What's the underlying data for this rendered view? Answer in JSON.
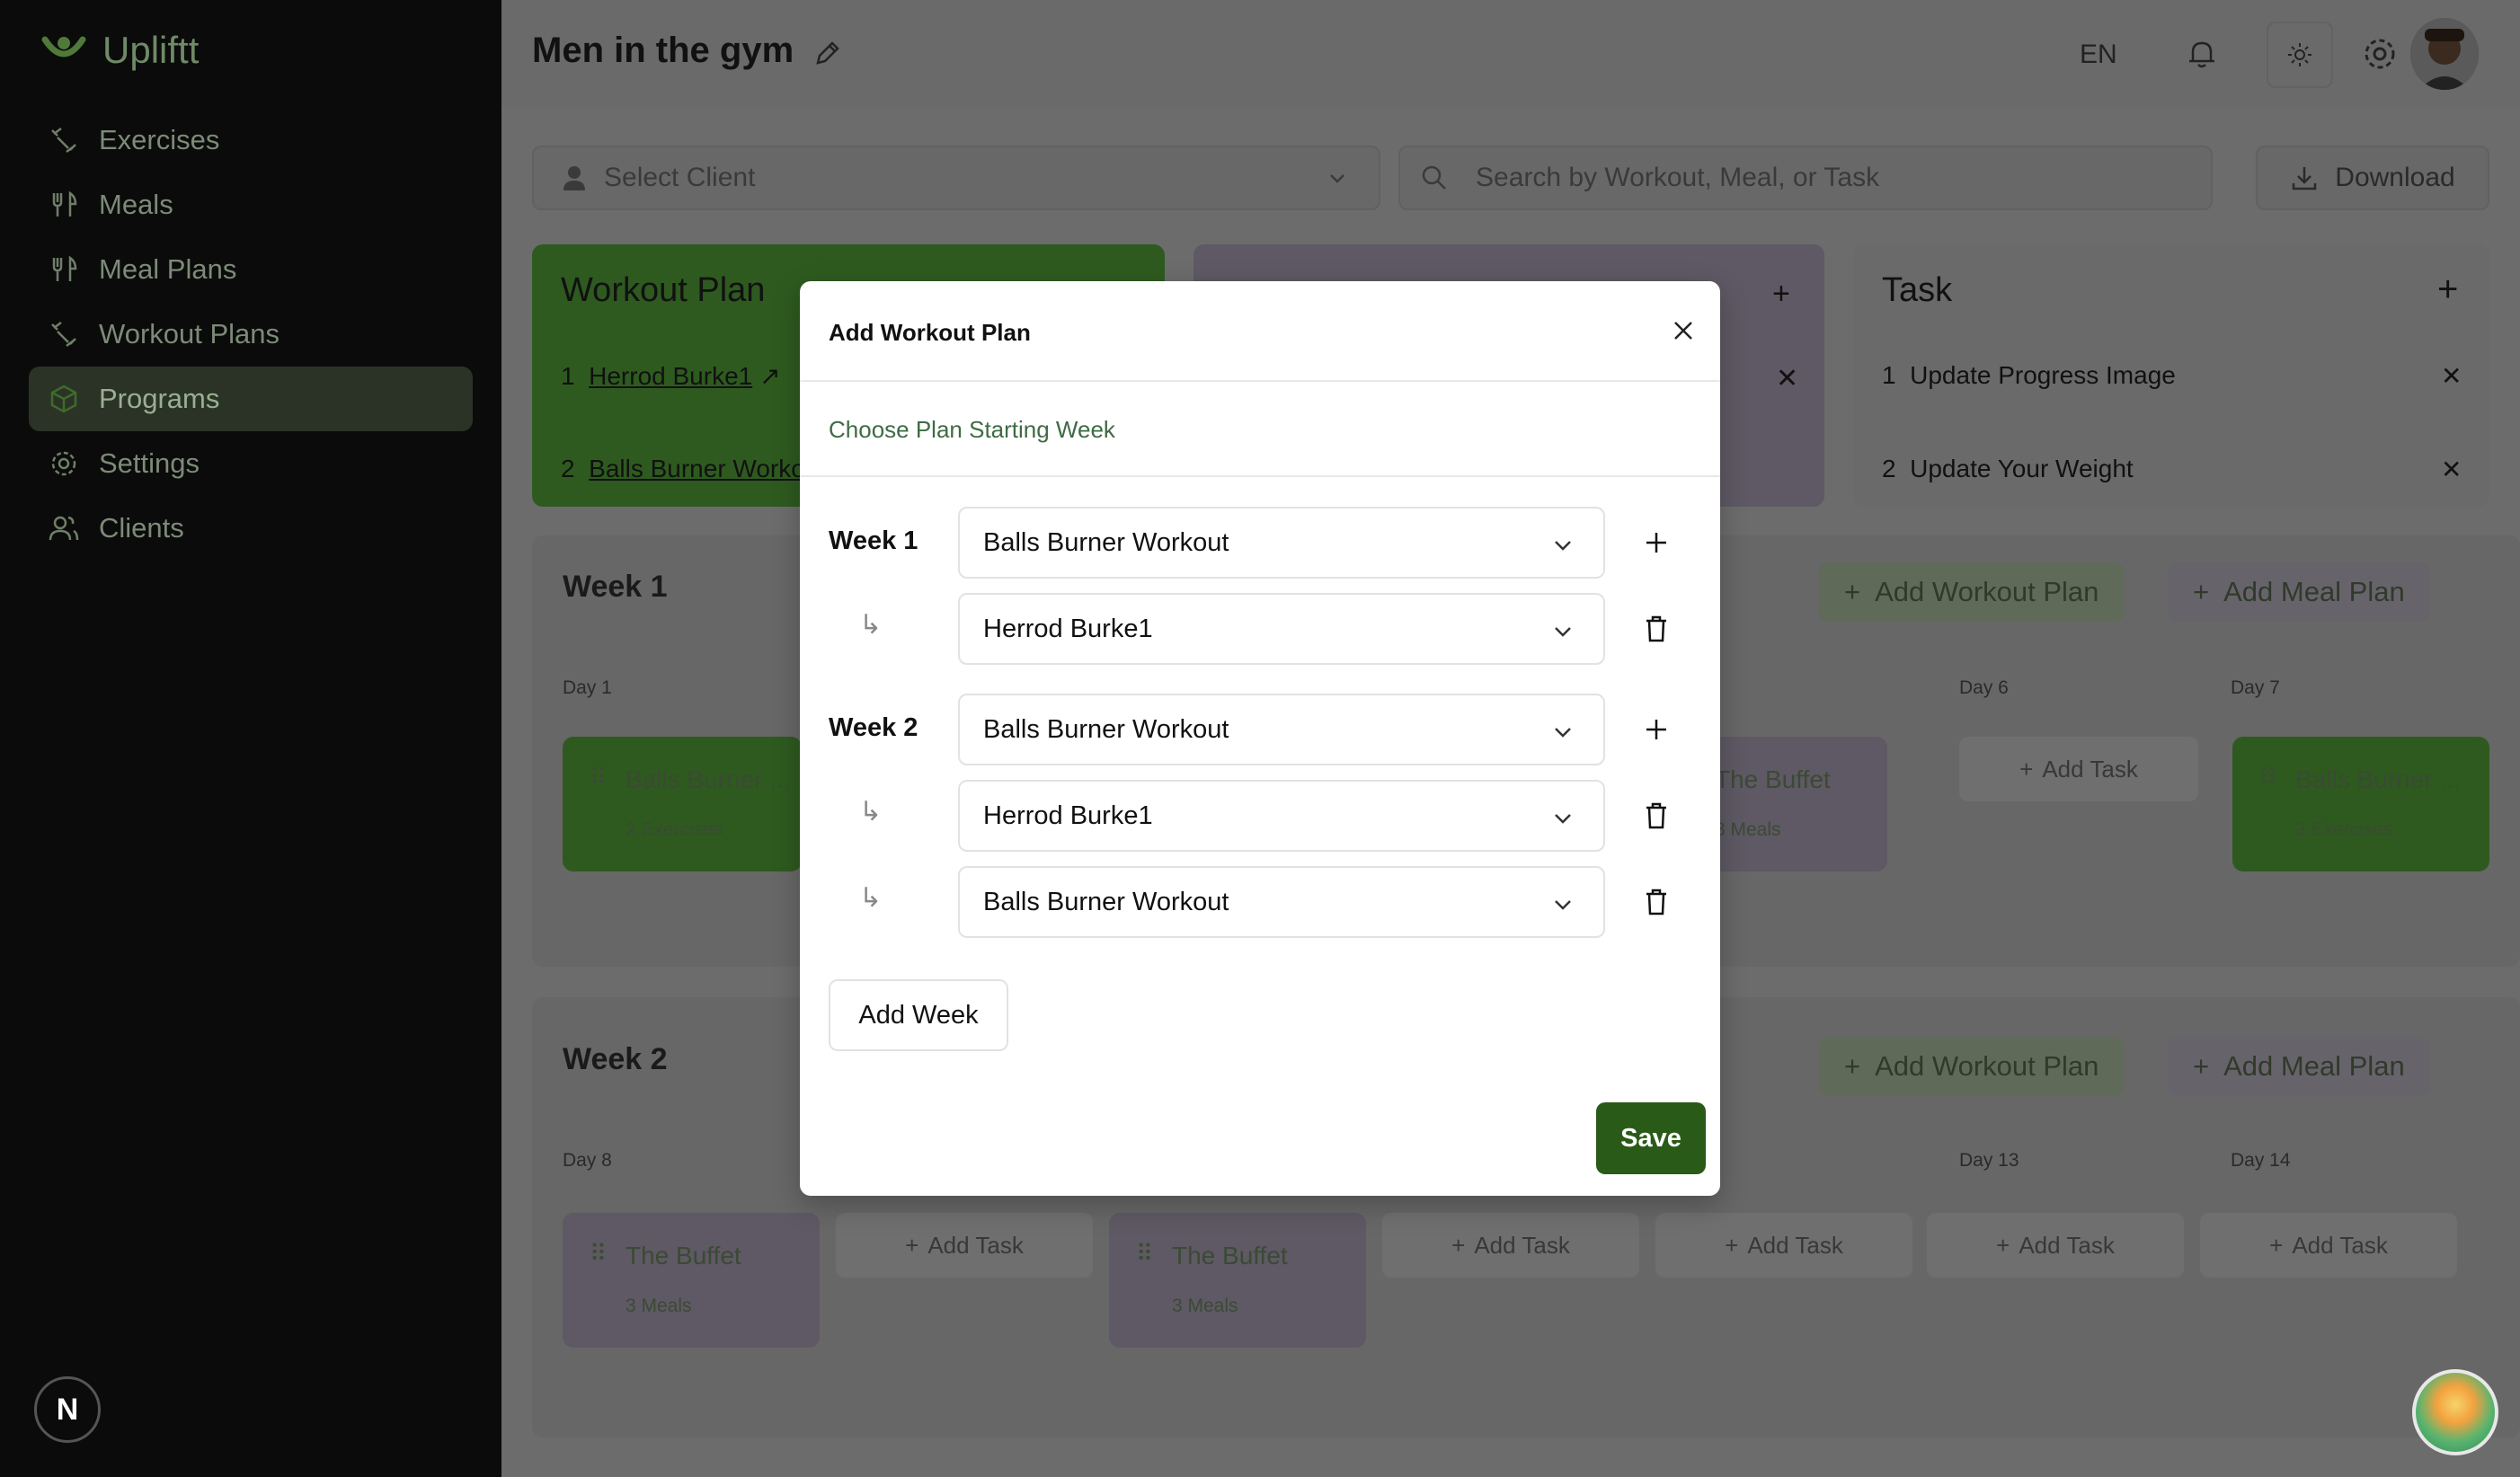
{
  "app": {
    "name": "Upliftt"
  },
  "sidebar": {
    "items": [
      {
        "label": "Exercises",
        "icon": "exercise-icon"
      },
      {
        "label": "Meals",
        "icon": "utensils-icon"
      },
      {
        "label": "Meal Plans",
        "icon": "utensils-icon"
      },
      {
        "label": "Workout Plans",
        "icon": "exercise-icon"
      },
      {
        "label": "Programs",
        "icon": "box-icon",
        "active": true
      },
      {
        "label": "Settings",
        "icon": "gear-icon"
      },
      {
        "label": "Clients",
        "icon": "users-icon"
      }
    ],
    "badge": "N"
  },
  "header": {
    "title": "Men in the gym",
    "language": "EN"
  },
  "toolbar": {
    "client_placeholder": "Select Client",
    "search_placeholder": "Search by Workout, Meal, or Task",
    "download_label": "Download"
  },
  "cards": {
    "workout": {
      "title": "Workout Plan",
      "items": [
        "Herrod Burke1",
        "Balls Burner Worko"
      ]
    },
    "task": {
      "title": "Task",
      "items": [
        "Update Progress Image",
        "Update Your Weight"
      ]
    }
  },
  "weeks": [
    {
      "title": "Week 1",
      "add_workout": "Add Workout Plan",
      "add_meal": "Add Meal Plan",
      "days": {
        "first": "Day 1",
        "sixth": "Day 6",
        "seventh": "Day 7"
      },
      "cards": {
        "d1_title": "Balls Burner ...",
        "d1_sub": "2 Exercises",
        "d5_title": "The Buffet",
        "d5_sub": "3 Meals",
        "d7_title": "Balls Burner ...",
        "d7_sub": "3 Exercises"
      },
      "add_task": "Add Task"
    },
    {
      "title": "Week 2",
      "add_workout": "Add Workout Plan",
      "add_meal": "Add Meal Plan",
      "days": {
        "first": "Day 8",
        "sixth": "Day 13",
        "seventh": "Day 14"
      },
      "cards": {
        "d8_title": "The Buffet",
        "d8_sub": "3 Meals",
        "d10_title": "The Buffet",
        "d10_sub": "3 Meals"
      },
      "add_task": "Add Task"
    }
  ],
  "modal": {
    "title": "Add Workout Plan",
    "subtitle": "Choose Plan Starting Week",
    "rows": [
      {
        "week": "Week 1",
        "value": "Balls Burner Workout",
        "action": "add"
      },
      {
        "week": "",
        "value": "Herrod Burke1",
        "action": "delete"
      },
      {
        "week": "Week 2",
        "value": "Balls Burner Workout",
        "action": "add"
      },
      {
        "week": "",
        "value": "Herrod Burke1",
        "action": "delete"
      },
      {
        "week": "",
        "value": "Balls Burner Workout",
        "action": "delete"
      }
    ],
    "add_week_label": "Add Week",
    "save_label": "Save"
  },
  "colors": {
    "accent": "#2a5a17",
    "sidebar_bg": "#0b0b0b",
    "workout_green": "#3e6b2a"
  }
}
